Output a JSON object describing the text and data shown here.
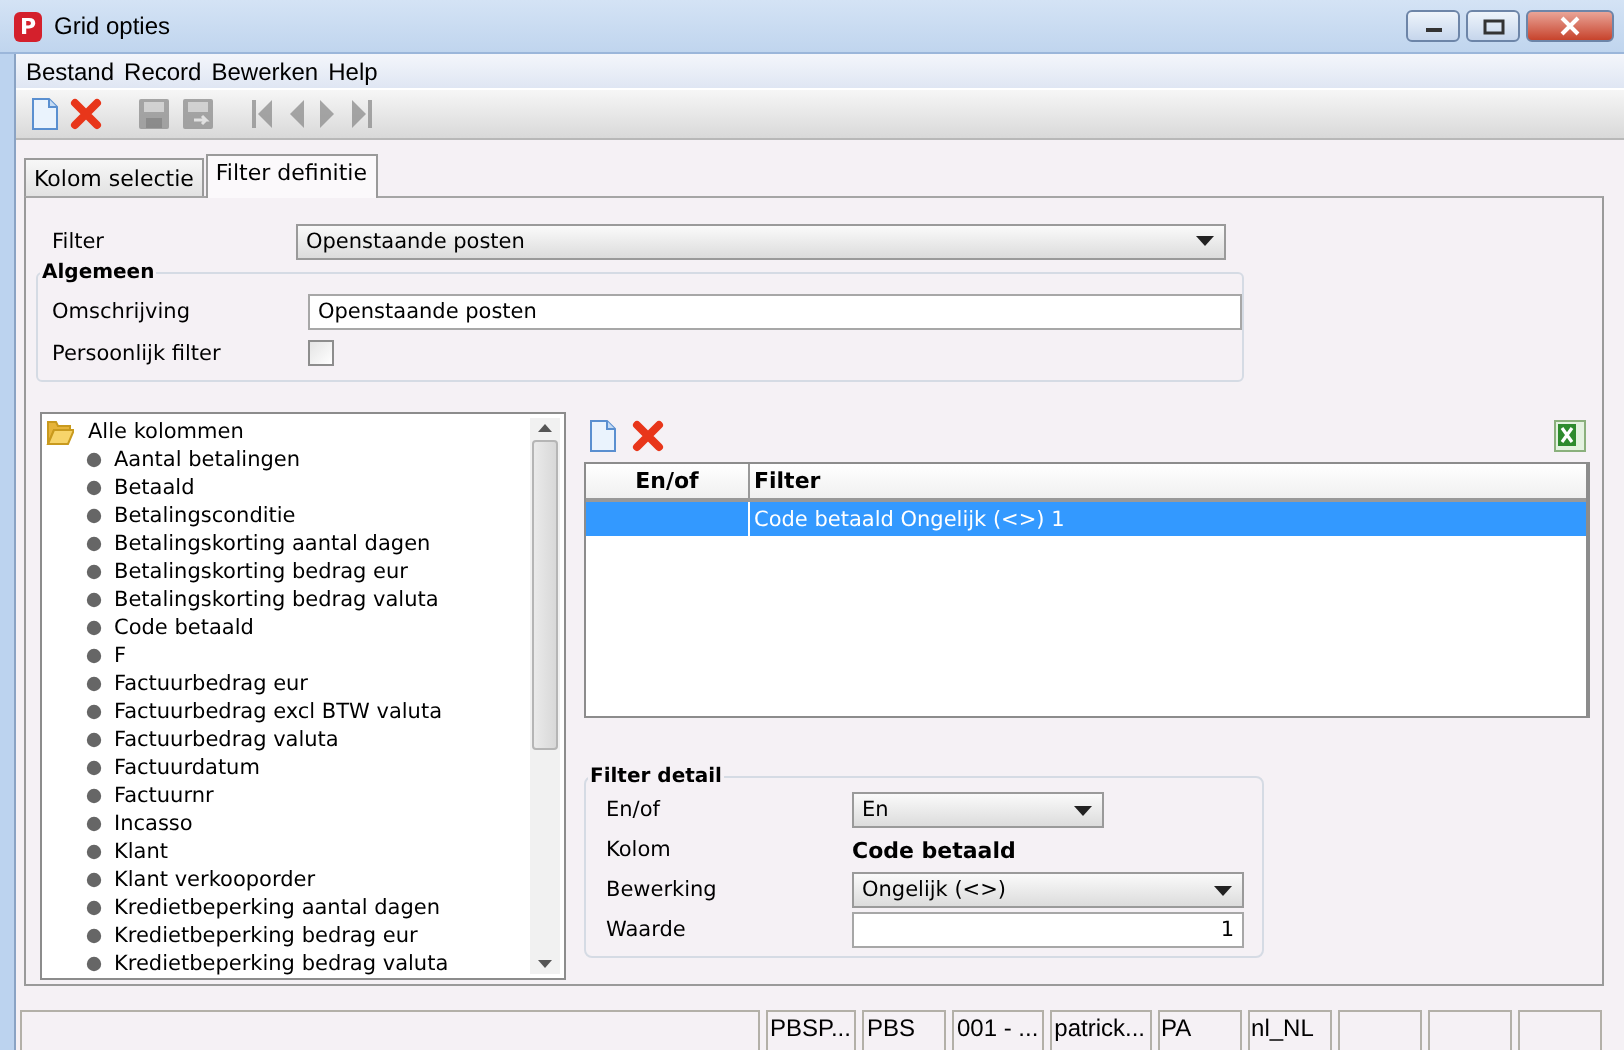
{
  "window": {
    "icon_letter": "P",
    "title": "Grid opties"
  },
  "menu": [
    {
      "label": "Bestand"
    },
    {
      "label": "Record"
    },
    {
      "label": "Bewerken"
    },
    {
      "label": "Help"
    }
  ],
  "toolbar": [
    {
      "kind": "new",
      "disabled": false
    },
    {
      "kind": "delete",
      "disabled": false
    },
    {
      "kind": "save",
      "disabled": true
    },
    {
      "kind": "save_as",
      "disabled": true
    },
    {
      "kind": "first",
      "disabled": true
    },
    {
      "kind": "previous",
      "disabled": true
    },
    {
      "kind": "next",
      "disabled": true
    },
    {
      "kind": "last",
      "disabled": true
    }
  ],
  "tabs": [
    {
      "label": "Kolom selectie",
      "selected": false
    },
    {
      "label": "Filter definitie",
      "selected": true
    }
  ],
  "filter": {
    "label": "Filter",
    "value": "Openstaande posten"
  },
  "general": {
    "title": "Algemeen",
    "description_label": "Omschrijving",
    "description_value": "Openstaande posten",
    "personal_label": "Persoonlijk filter",
    "personal_checked": false
  },
  "column_tree": {
    "label": "Alle kolommen",
    "expanded": true,
    "children": [
      {
        "label": "Aantal betalingen"
      },
      {
        "label": "Betaald"
      },
      {
        "label": "Betalingsconditie"
      },
      {
        "label": "Betalingskorting aantal dagen"
      },
      {
        "label": "Betalingskorting bedrag eur"
      },
      {
        "label": "Betalingskorting bedrag valuta"
      },
      {
        "label": "Code betaald"
      },
      {
        "label": "F"
      },
      {
        "label": "Factuurbedrag eur"
      },
      {
        "label": "Factuurbedrag excl BTW valuta"
      },
      {
        "label": "Factuurbedrag valuta"
      },
      {
        "label": "Factuurdatum"
      },
      {
        "label": "Factuurnr"
      },
      {
        "label": "Incasso"
      },
      {
        "label": "Klant"
      },
      {
        "label": "Klant verkooporder"
      },
      {
        "label": "Kredietbeperking aantal dagen"
      },
      {
        "label": "Kredietbeperking bedrag eur"
      },
      {
        "label": "Kredietbeperking bedrag valuta"
      }
    ]
  },
  "grid_toolbar": [
    {
      "kind": "new"
    },
    {
      "kind": "delete"
    },
    {
      "kind": "excel"
    }
  ],
  "filter_grid": {
    "columns": [
      "En/of",
      "Filter"
    ],
    "rows": [
      {
        "filter": "Code betaald Ongelijk (<>) 1",
        "selected": true
      }
    ]
  },
  "filter_detail": {
    "title": "Filter detail",
    "fields": [
      {
        "kind": "dropdown",
        "label": "En/of",
        "value": "En"
      },
      {
        "kind": "text",
        "label": "Kolom",
        "value": "Code betaald"
      },
      {
        "kind": "dropdown",
        "label": "Bewerking",
        "value": "Ongelijk (<>)"
      },
      {
        "kind": "input",
        "label": "Waarde",
        "value": "1"
      }
    ]
  },
  "status_bar": [
    "PBSP...",
    "PBS",
    "001 - ...",
    "patrick...",
    "PA",
    "nl_NL"
  ]
}
